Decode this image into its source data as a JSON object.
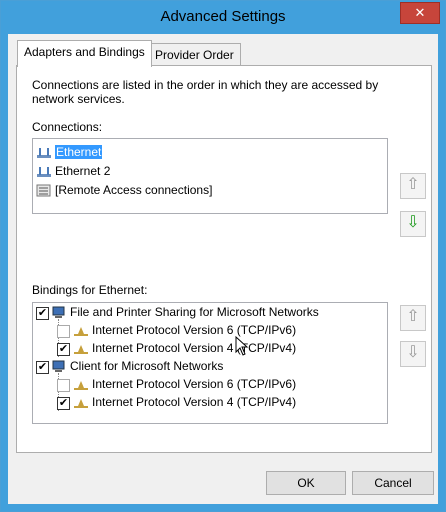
{
  "window": {
    "title": "Advanced Settings",
    "close_label": "✕"
  },
  "tabs": [
    {
      "label": "Adapters and Bindings",
      "active": true
    },
    {
      "label": "Provider Order",
      "active": false
    }
  ],
  "description": "Connections are listed in the order in which they are accessed by network services.",
  "connections": {
    "label": "Connections:",
    "items": [
      {
        "label": "Ethernet",
        "selected": true
      },
      {
        "label": "Ethernet 2",
        "selected": false
      },
      {
        "label": "[Remote Access connections]",
        "selected": false
      }
    ]
  },
  "bindings": {
    "label": "Bindings for Ethernet:",
    "items": [
      {
        "label": "File and Printer Sharing for Microsoft Networks",
        "checked": true
      },
      {
        "label": "Internet Protocol Version 6 (TCP/IPv6)",
        "checked": false
      },
      {
        "label": "Internet Protocol Version 4 (TCP/IPv4)",
        "checked": true
      },
      {
        "label": "Client for Microsoft Networks",
        "checked": true
      },
      {
        "label": "Internet Protocol Version 6 (TCP/IPv6)",
        "checked": false
      },
      {
        "label": "Internet Protocol Version 4 (TCP/IPv4)",
        "checked": true
      }
    ]
  },
  "arrows": {
    "up": "⇧",
    "down": "⇩"
  },
  "check_mark": "✔",
  "buttons": {
    "ok": "OK",
    "cancel": "Cancel"
  }
}
